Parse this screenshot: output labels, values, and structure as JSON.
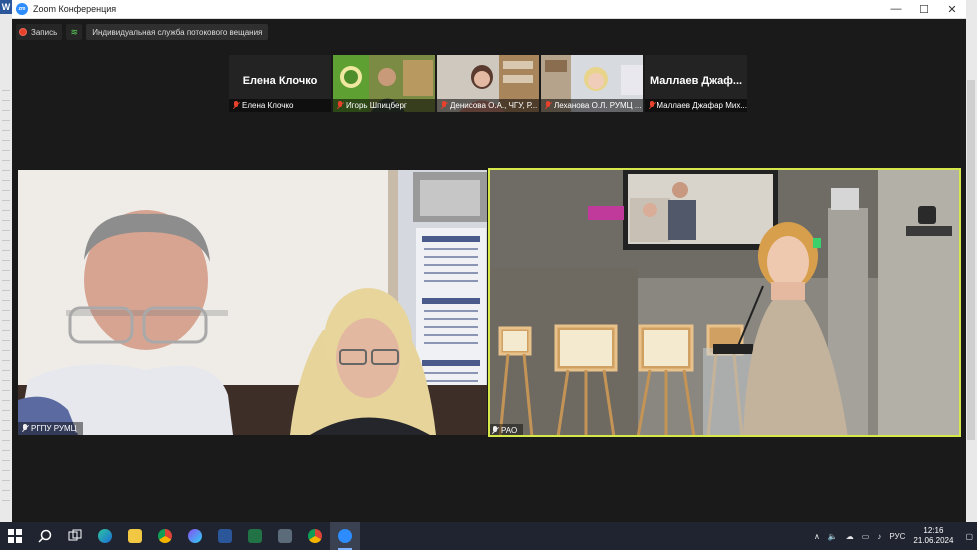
{
  "desktop": {
    "left_app_icon": "W"
  },
  "window": {
    "title": "Zoom Конференция",
    "controls": {
      "minimize": "—",
      "maximize": "☐",
      "close": "✕"
    }
  },
  "toolbar": {
    "record_label": "Запись",
    "live_stream_label": "Индивидуальная служба потокового вещания"
  },
  "thumbnails": [
    {
      "display_name": "Елена Клочко",
      "label": "Елена Клочко",
      "muted": true,
      "video": false
    },
    {
      "display_name": "",
      "label": "Игорь Шпицберг",
      "muted": true,
      "video": true
    },
    {
      "display_name": "",
      "label": "Денисова О.А., ЧГУ, Р...",
      "muted": true,
      "video": true
    },
    {
      "display_name": "",
      "label": "Леханова О.Л. РУМЦ ...",
      "muted": true,
      "video": true
    },
    {
      "display_name": "Маллаев Джаф...",
      "label": "Маллаев Джафар Мих...",
      "muted": true,
      "video": false
    }
  ],
  "main_videos": [
    {
      "label": "РГПУ РУМЦ",
      "active": false
    },
    {
      "label": "РАО",
      "active": true
    }
  ],
  "taskbar": {
    "apps": [
      "start-icon",
      "search-icon",
      "task-view-icon",
      "edge-icon",
      "explorer-icon",
      "chrome-icon",
      "app-icon",
      "word-icon",
      "excel-icon",
      "calculator-icon",
      "chrome-icon",
      "zoom-icon"
    ],
    "tray": {
      "chevron": "∧",
      "language": "РУС",
      "time": "12:16",
      "date": "21.06.2024"
    }
  },
  "colors": {
    "accent_active_speaker": "#d7e84a",
    "record_red": "#e8412b",
    "zoom_blue": "#2d8cff"
  }
}
